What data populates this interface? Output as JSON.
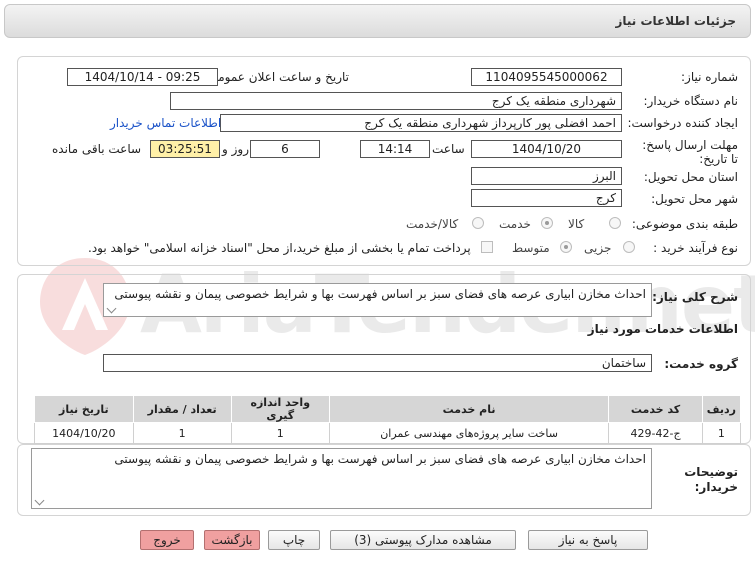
{
  "header": {
    "title": "جزئیات اطلاعات نیاز"
  },
  "form": {
    "need_number_label": "شماره نیاز:",
    "need_number": "1104095545000062",
    "announce_label": "تاریخ و ساعت اعلان عمومی:",
    "announce_value": "1404/10/14 - 09:25",
    "buyer_org_label": "نام دستگاه خریدار:",
    "buyer_org": "شهرداری منطقه یک کرج",
    "creator_label": "ایجاد کننده درخواست:",
    "creator": "احمد افضلی پور کارپرداز شهرداری منطقه یک کرج",
    "contact_link": "اطلاعات تماس خریدار",
    "deadline_label": "مهلت ارسال پاسخ: تا تاریخ:",
    "deadline_date": "1404/10/20",
    "time_label": "ساعت",
    "deadline_time": "14:14",
    "days_value": "6",
    "days_label": "روز و",
    "remaining_time": "03:25:51",
    "remaining_label": "ساعت باقی مانده",
    "province_label": "استان محل تحویل:",
    "province": "البرز",
    "city_label": "شهر محل تحویل:",
    "city": "کرج",
    "category_label": "طبقه بندی موضوعی:",
    "category_options": [
      "کالا",
      "خدمت",
      "کالا/خدمت"
    ],
    "process_label": "نوع فرآیند خرید :",
    "process_options": [
      "جزیی",
      "متوسط"
    ],
    "payment_note": "پرداخت تمام یا بخشی از مبلغ خرید،از محل \"اسناد خزانه اسلامی\" خواهد بود."
  },
  "summary": {
    "label": "شرح کلی نیاز:",
    "text": "احداث مخازن  ابیاری عرصه های فضای سبز  بر اساس فهرست بها  و شرایط خصوصی پیمان و نقشه پیوستی"
  },
  "services": {
    "section_title": "اطلاعات خدمات مورد نیاز",
    "group_label": "گروه خدمت:",
    "group_value": "ساختمان",
    "columns": [
      "ردیف",
      "کد خدمت",
      "نام خدمت",
      "واحد اندازه گیری",
      "تعداد / مقدار",
      "تاریخ نیاز"
    ],
    "rows": [
      {
        "row": "1",
        "code": "ج-42-429",
        "name": "ساخت سایر پروژه‌های مهندسی عمران",
        "unit": "1",
        "qty": "1",
        "date": "1404/10/20"
      }
    ]
  },
  "buyer_notes": {
    "label": "توضیحات خریدار:",
    "text": "احداث مخازن  ابیاری عرصه های فضای سبز  بر اساس فهرست بها  و شرایط خصوصی پیمان و نقشه پیوستی"
  },
  "buttons": {
    "reply": "پاسخ به نیاز",
    "view_docs": "مشاهده مدارک پیوستی (3)",
    "print": "چاپ",
    "back": "بازگشت",
    "exit": "خروج"
  },
  "watermark": "AriaTender.net"
}
